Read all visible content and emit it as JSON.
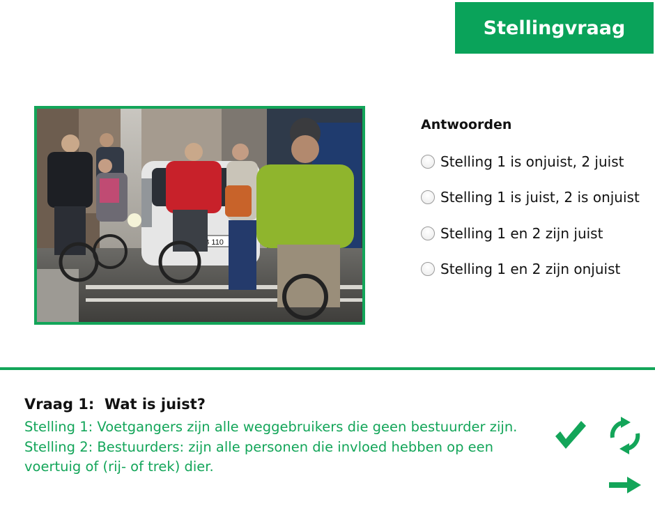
{
  "header": {
    "question_type": "Stellingvraag"
  },
  "photo": {
    "plate_text": "B 110"
  },
  "answers": {
    "title": "Antwoorden",
    "options": [
      "Stelling 1 is onjuist, 2 juist",
      "Stelling 1 is juist, 2 is onjuist",
      "Stelling 1 en 2 zijn juist",
      "Stelling 1 en 2 zijn onjuist"
    ]
  },
  "question": {
    "title": "Vraag 1:  Wat is juist?",
    "lines": [
      "Stelling 1: Voetgangers zijn alle weggebruikers die geen bestuurder zijn.",
      "Stelling 2: Bestuurders: zijn alle personen die invloed hebben op een",
      "voertuig of (rij- of trek) dier."
    ]
  },
  "controls": {
    "check_icon": "checkmark-icon",
    "refresh_icon": "refresh-icon",
    "next_icon": "arrow-right-icon"
  },
  "colors": {
    "accent": "#13a559"
  }
}
